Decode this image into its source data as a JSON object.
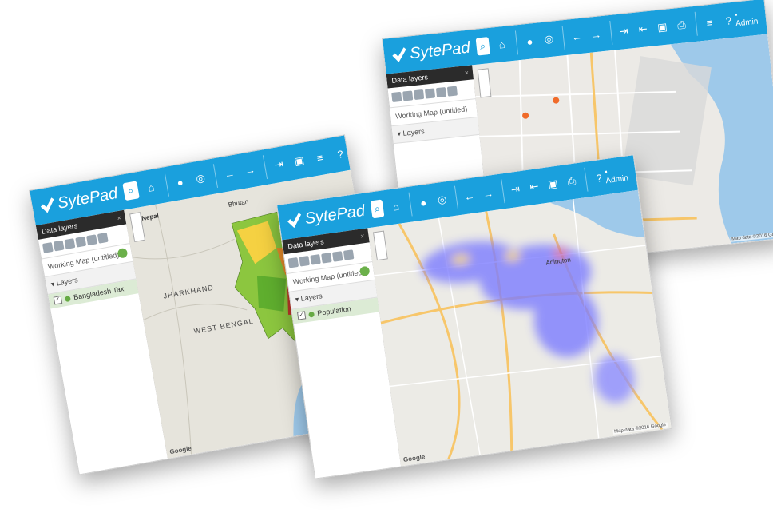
{
  "app": {
    "brand": "SytePad",
    "user_label": "Admin"
  },
  "panel": {
    "data_layers_title": "Data layers",
    "close_glyph": "×",
    "working_map_title": "Working Map (untitled)",
    "layers_header": "Layers",
    "expand_glyph": "▾"
  },
  "windows": {
    "bangladesh": {
      "layer_name": "Bangladesh Tax",
      "map_labels": {
        "nepal": "Nepal",
        "bhutan": "Bhutan",
        "west_bengal": "WEST BENGAL",
        "jharkhand": "JHARKHAND"
      }
    },
    "heatmap": {
      "layer_name": "Population",
      "map_labels": {
        "city": "Arlington"
      }
    },
    "streets": {
      "layer_name": ""
    }
  },
  "attribution": {
    "google": "Google",
    "copyright": "Map data ©2016 Google"
  },
  "icons": [
    "logo-check-icon",
    "search-icon",
    "home-icon",
    "globe-icon",
    "locate-icon",
    "back-icon",
    "forward-icon",
    "export-icon",
    "import-icon",
    "save-icon",
    "print-icon",
    "database-icon",
    "help-icon",
    "user-icon"
  ],
  "colors": {
    "toolbar": "#1aa0dd",
    "panel_header": "#2b2b2b",
    "layer_row": "#dcebd5",
    "water": "#9ec9ea",
    "heat_blue": "#7b7bff",
    "heat_hot": "#f5d142"
  }
}
